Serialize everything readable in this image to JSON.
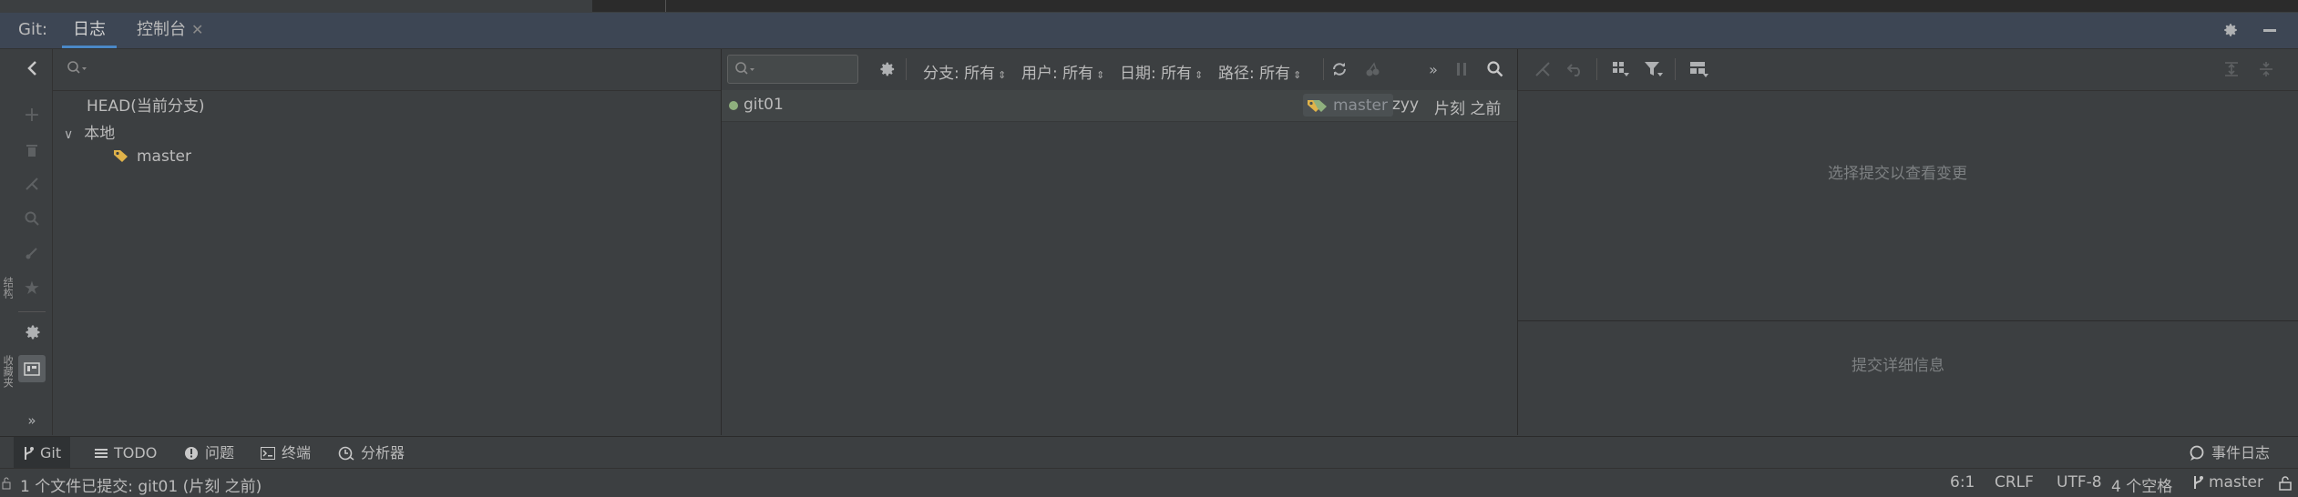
{
  "header": {
    "tool_label": "Git:",
    "tabs": [
      {
        "label": "日志",
        "active": true
      },
      {
        "label": "控制台",
        "active": false
      }
    ]
  },
  "tree": {
    "items": [
      {
        "label": "HEAD(当前分支)"
      },
      {
        "label": "本地",
        "expanded": true
      },
      {
        "label": "master"
      }
    ]
  },
  "log": {
    "filters": {
      "branch": "分支: 所有",
      "user": "用户: 所有",
      "date": "日期: 所有",
      "path": "路径: 所有"
    },
    "commits": [
      {
        "message": "git01",
        "tag": "master",
        "author": "zyy",
        "time": "片刻 之前"
      }
    ]
  },
  "detail": {
    "placeholder_changes": "选择提交以查看变更",
    "placeholder_details": "提交详细信息"
  },
  "sidebar_vertical": [
    "结构",
    "收藏夹"
  ],
  "bottom_tabs": [
    {
      "label": "Git",
      "active": true,
      "icon": "git-branch-icon"
    },
    {
      "label": "TODO",
      "active": false,
      "icon": "list-icon"
    },
    {
      "label": "问题",
      "active": false,
      "icon": "info-icon"
    },
    {
      "label": "终端",
      "active": false,
      "icon": "terminal-icon"
    },
    {
      "label": "分析器",
      "active": false,
      "icon": "profiler-icon"
    }
  ],
  "event_log": "事件日志",
  "status": {
    "message": "1 个文件已提交: git01 (片刻 之前)",
    "position": "6:1",
    "line_sep": "CRLF",
    "encoding": "UTF-8",
    "indent": "4 个空格",
    "branch": "master"
  },
  "colors": {
    "accent": "#4a88c7",
    "commit_dot": "#8fb07e",
    "tag_icon": "#e0b34a"
  }
}
